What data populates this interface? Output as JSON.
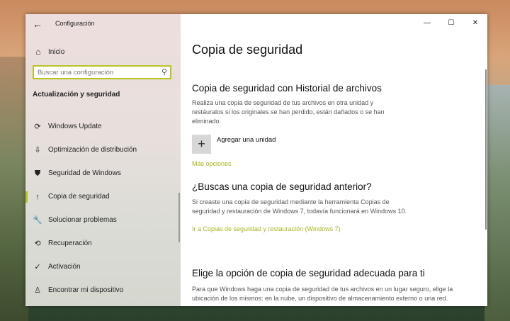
{
  "window": {
    "title": "Configuración",
    "back_icon": "←",
    "controls": {
      "minimize": "—",
      "maximize": "☐",
      "close": "✕"
    }
  },
  "sidebar": {
    "home_icon": "⌂",
    "home_label": "Inicio",
    "search_placeholder": "Buscar una configuración",
    "search_icon": "⚲",
    "section_title": "Actualización y seguridad",
    "items": [
      {
        "label": "Windows Update",
        "icon": "⟳",
        "active": false
      },
      {
        "label": "Optimización de distribución",
        "icon": "⇩",
        "active": false
      },
      {
        "label": "Seguridad de Windows",
        "icon": "⛊",
        "active": false
      },
      {
        "label": "Copia de seguridad",
        "icon": "↑",
        "active": true
      },
      {
        "label": "Solucionar problemas",
        "icon": "🔧",
        "active": false
      },
      {
        "label": "Recuperación",
        "icon": "⟲",
        "active": false
      },
      {
        "label": "Activación",
        "icon": "✓",
        "active": false
      },
      {
        "label": "Encontrar mi dispositivo",
        "icon": "♙",
        "active": false
      }
    ],
    "accent_color": "#b8c424"
  },
  "main": {
    "page_title": "Copia de seguridad",
    "history": {
      "heading": "Copia de seguridad con Historial de archivos",
      "description": "Realiza una copia de seguridad de tus archivos en otra unidad y restáuralos si los originales se han perdido, están dañados o se han eliminado.",
      "add_drive_label": "Agregar una unidad",
      "add_drive_icon": "+",
      "more_options": "Más opciones"
    },
    "older": {
      "heading": "¿Buscas una copia de seguridad anterior?",
      "description": "Si creaste una copia de seguridad mediante la herramienta Copias de seguridad y restauración de Windows 7, todavía funcionará en Windows 10.",
      "link": "Ir a Copias de seguridad y restauración (Windows 7)"
    },
    "choose": {
      "heading": "Elige la opción de copia de seguridad adecuada para ti",
      "description": "Para que Windows haga una copia de seguridad de tus archivos en un lugar seguro, elige la ubicación de los mismos: en la nube, un dispositivo de almacenamiento externo o una red."
    },
    "link_color": "#a8b41c"
  }
}
